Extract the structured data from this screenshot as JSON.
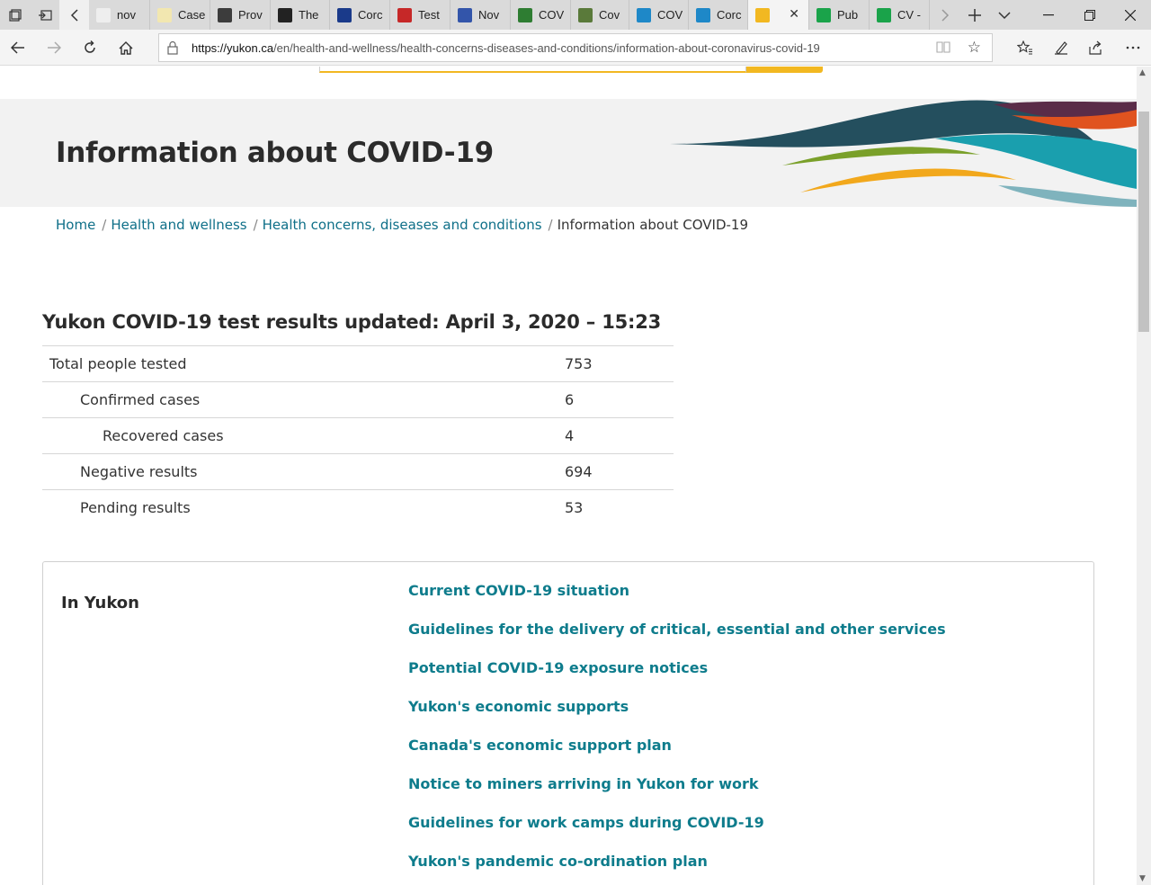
{
  "browser": {
    "tabs": [
      {
        "label": "nov",
        "color": "#eeeeee"
      },
      {
        "label": "Case",
        "color": "#f2e7b0"
      },
      {
        "label": "Prov",
        "color": "#3c3c3c"
      },
      {
        "label": "The",
        "color": "#222222"
      },
      {
        "label": "Corc",
        "color": "#1a3a8a"
      },
      {
        "label": "Test",
        "color": "#c62828"
      },
      {
        "label": "Nov",
        "color": "#3355aa"
      },
      {
        "label": "COV",
        "color": "#2e7d32"
      },
      {
        "label": "Cov",
        "color": "#5a7a3a"
      },
      {
        "label": "COV",
        "color": "#1e88c8"
      },
      {
        "label": "Corc",
        "color": "#1e88c8"
      },
      {
        "label": "",
        "color": "#f2b821"
      },
      {
        "label": "Pub",
        "color": "#1aa34a"
      },
      {
        "label": "CV -",
        "color": "#1aa34a"
      }
    ],
    "url_domain": "https://yukon.ca",
    "url_path": "/en/health-and-wellness/health-concerns-diseases-and-conditions/information-about-coronavirus-covid-19"
  },
  "page": {
    "title": "Information about COVID-19",
    "breadcrumb": [
      "Home",
      "Health and wellness",
      "Health concerns, diseases and conditions",
      "Information about COVID-19"
    ],
    "results": {
      "title": "Yukon COVID-19 test results updated: April 3, 2020 – 15:23",
      "rows": [
        {
          "label": "Total people tested",
          "value": "753"
        },
        {
          "label": "Confirmed cases",
          "value": "6"
        },
        {
          "label": "Recovered cases",
          "value": "4"
        },
        {
          "label": "Negative results",
          "value": "694"
        },
        {
          "label": "Pending results",
          "value": "53"
        }
      ]
    },
    "in_yukon": {
      "title": "In Yukon",
      "links": [
        "Current COVID-19 situation",
        "Guidelines for the delivery of critical, essential and other services",
        "Potential COVID-19 exposure notices",
        "Yukon's economic supports",
        "Canada's economic support plan",
        "Notice to miners arriving in Yukon for work",
        "Guidelines for work camps during COVID-19",
        "Yukon's pandemic co-ordination plan"
      ]
    }
  },
  "colors": {
    "link": "#0e7c8c",
    "accent_yellow": "#f2b821",
    "banner_bg": "#f2f2f2"
  }
}
